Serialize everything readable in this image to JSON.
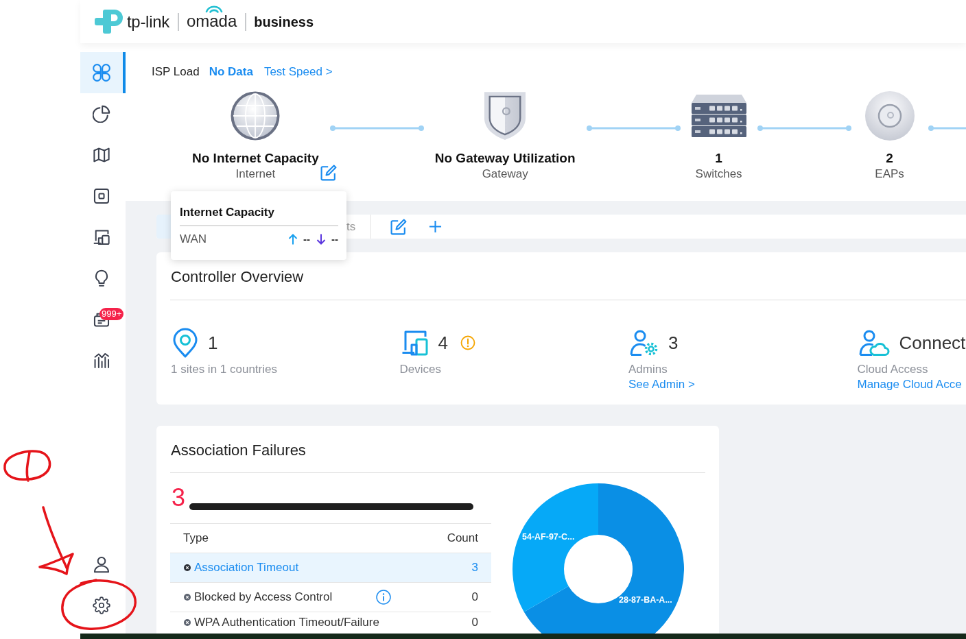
{
  "header": {
    "logo": {
      "brand": "tp-link",
      "product": "omada",
      "edition": "business"
    }
  },
  "sidebar": {
    "items": [
      {
        "kind": "grid",
        "selected": true
      },
      {
        "kind": "pie",
        "selected": false
      },
      {
        "kind": "map",
        "selected": false
      },
      {
        "kind": "square",
        "selected": false
      },
      {
        "kind": "screens",
        "selected": false
      },
      {
        "kind": "bulb",
        "selected": false
      },
      {
        "kind": "tray",
        "selected": false,
        "badge": "999+"
      },
      {
        "kind": "bars",
        "selected": false
      }
    ],
    "bottom_items": [
      {
        "kind": "person",
        "selected": false
      },
      {
        "kind": "gear",
        "selected": false
      }
    ]
  },
  "topology": {
    "isp_load": {
      "label": "ISP Load",
      "value": "No Data",
      "link": "Test Speed >"
    },
    "nodes": [
      {
        "kind": "globe",
        "title": "No Internet Capacity",
        "subtitle": "Internet",
        "edit": true
      },
      {
        "kind": "shield",
        "title": "No Gateway Utilization",
        "subtitle": "Gateway"
      },
      {
        "kind": "switch",
        "title": "1",
        "subtitle": "Switches"
      },
      {
        "kind": "disc",
        "title": "2",
        "subtitle": "EAPs"
      }
    ]
  },
  "tooltip": {
    "title": "Internet Capacity",
    "rows": [
      {
        "label": "WAN",
        "upload": "--",
        "download": "--"
      }
    ]
  },
  "tabs": [
    {
      "selected": true
    },
    {
      "label": "ts",
      "selected": false
    }
  ],
  "controller_overview": {
    "title": "Controller Overview",
    "stats": [
      {
        "kind": "pin",
        "value": "1",
        "caption": "1 sites in 1 countries"
      },
      {
        "kind": "screens",
        "value": "4",
        "caption": "Devices",
        "warning": true
      },
      {
        "kind": "admin",
        "value": "3",
        "caption": "Admins",
        "link": "See Admin >"
      },
      {
        "kind": "cloud",
        "value": "Connect",
        "caption": "Cloud Access",
        "link": "Manage Cloud Acce"
      }
    ]
  },
  "association_failures": {
    "title": "Association Failures",
    "total": "3",
    "columns": [
      "Type",
      "Count"
    ],
    "rows": [
      {
        "type": "Association Timeout",
        "count": "3",
        "selected": true
      },
      {
        "type": "Blocked by Access Control",
        "count": "0",
        "selected": false,
        "info": true
      },
      {
        "type": "WPA Authentication Timeout/Failure",
        "count": "0",
        "selected": false
      }
    ],
    "donut_labels": [
      "54-AF-97-C...",
      "28-87-BA-A..."
    ]
  },
  "annotations": [
    {
      "kind": "scribble"
    },
    {
      "kind": "arrow"
    },
    {
      "kind": "ellipse"
    }
  ]
}
